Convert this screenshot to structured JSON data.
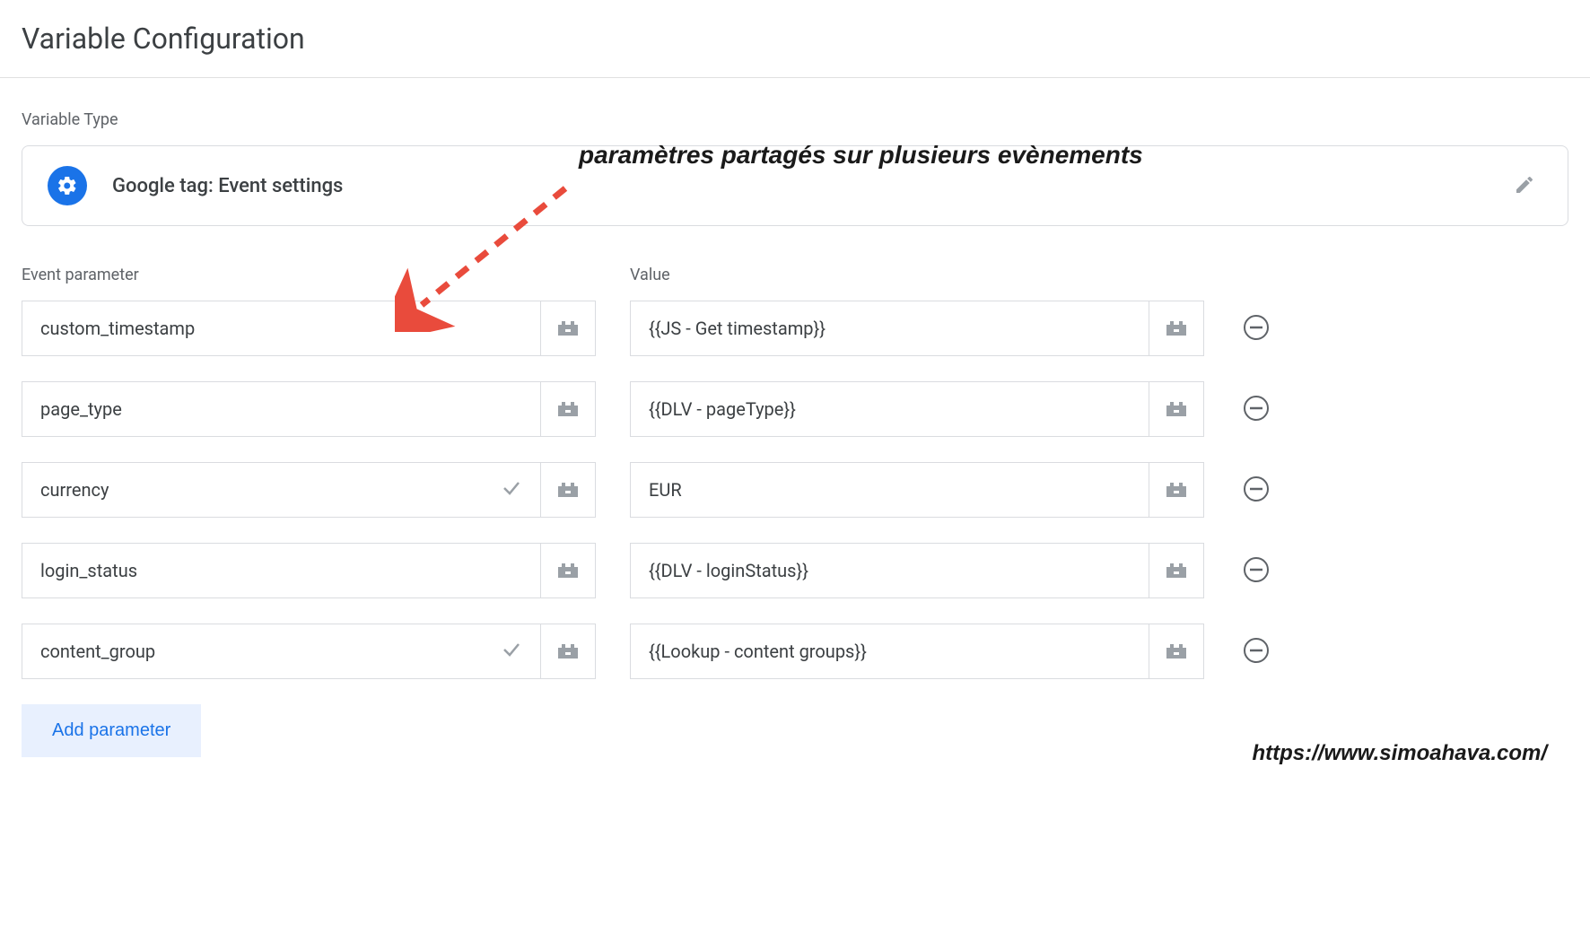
{
  "title": "Variable Configuration",
  "variableTypeLabel": "Variable Type",
  "variableTypeName": "Google tag: Event settings",
  "annotation": "paramètres partagés sur plusieurs evènements",
  "columns": {
    "param": "Event parameter",
    "value": "Value"
  },
  "rows": [
    {
      "param": "custom_timestamp",
      "value": "{{JS - Get timestamp}}",
      "paramValidated": false
    },
    {
      "param": "page_type",
      "value": "{{DLV - pageType}}",
      "paramValidated": false
    },
    {
      "param": "currency",
      "value": "EUR",
      "paramValidated": true
    },
    {
      "param": "login_status",
      "value": "{{DLV - loginStatus}}",
      "paramValidated": false
    },
    {
      "param": "content_group",
      "value": "{{Lookup - content groups}}",
      "paramValidated": true
    }
  ],
  "addButton": "Add parameter",
  "watermark": "https://www.simoahava.com/"
}
